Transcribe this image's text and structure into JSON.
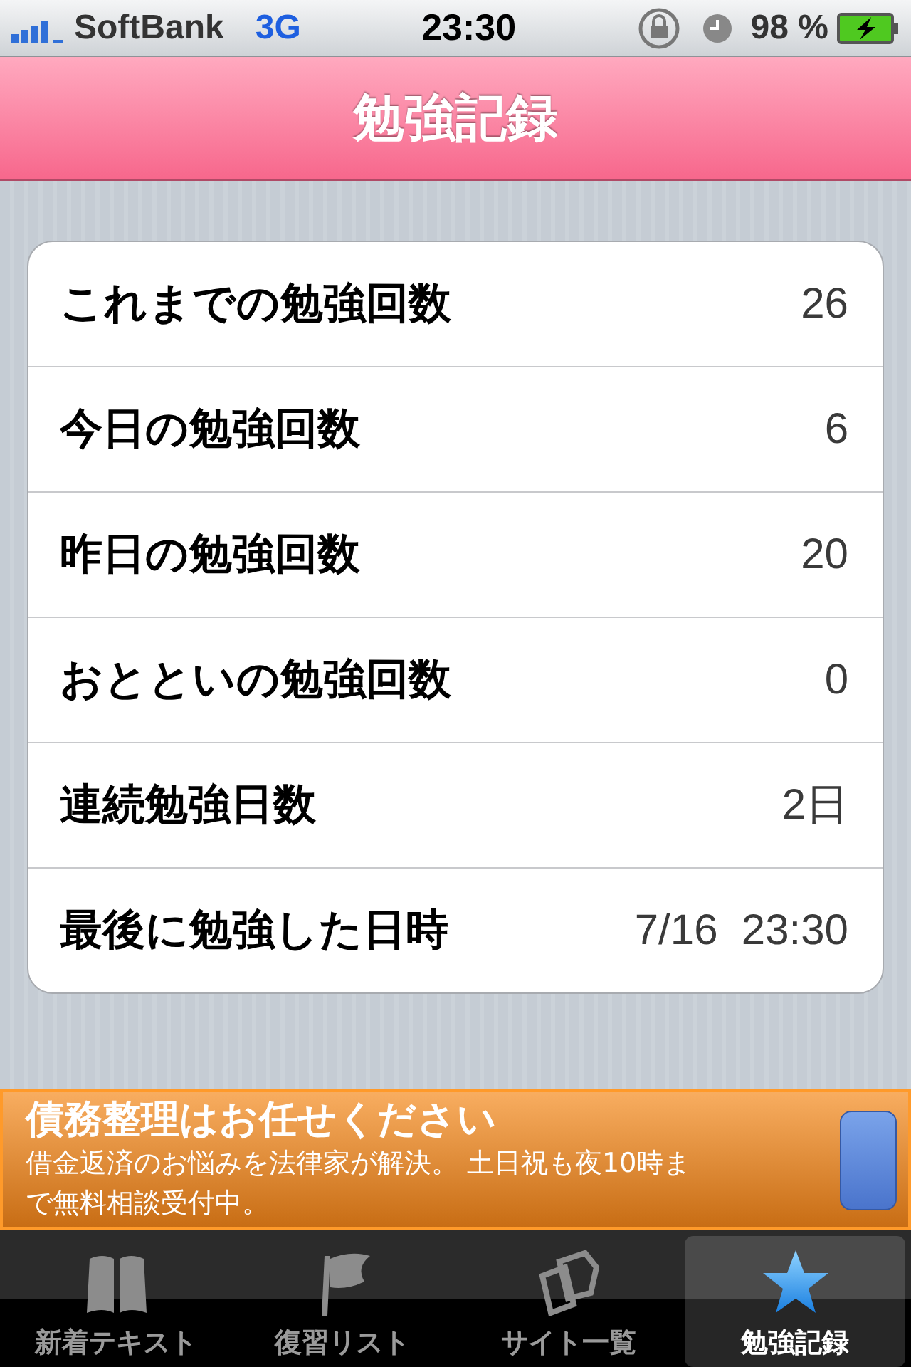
{
  "status_bar": {
    "carrier": "SoftBank",
    "network": "3G",
    "time": "23:30",
    "battery": "98 %"
  },
  "nav_bar": {
    "title": "勉強記録"
  },
  "stats": [
    {
      "label": "これまでの勉強回数",
      "value": "26"
    },
    {
      "label": "今日の勉強回数",
      "value": "6"
    },
    {
      "label": "昨日の勉強回数",
      "value": "20"
    },
    {
      "label": "おとといの勉強回数",
      "value": "0"
    },
    {
      "label": "連続勉強日数",
      "value": "2日"
    },
    {
      "label": "最後に勉強した日時",
      "value": "7/16  23:30"
    }
  ],
  "ad": {
    "title": "債務整理はお任せください",
    "body": "借金返済のお悩みを法律家が解決。 土日祝も夜10時まで無料相談受付中。"
  },
  "tabs": [
    {
      "label": "新着テキスト",
      "kind": "book",
      "selected": false
    },
    {
      "label": "復習リスト",
      "kind": "flag",
      "selected": false
    },
    {
      "label": "サイト一覧",
      "kind": "pages",
      "selected": false
    },
    {
      "label": "勉強記録",
      "kind": "star",
      "selected": true
    }
  ]
}
